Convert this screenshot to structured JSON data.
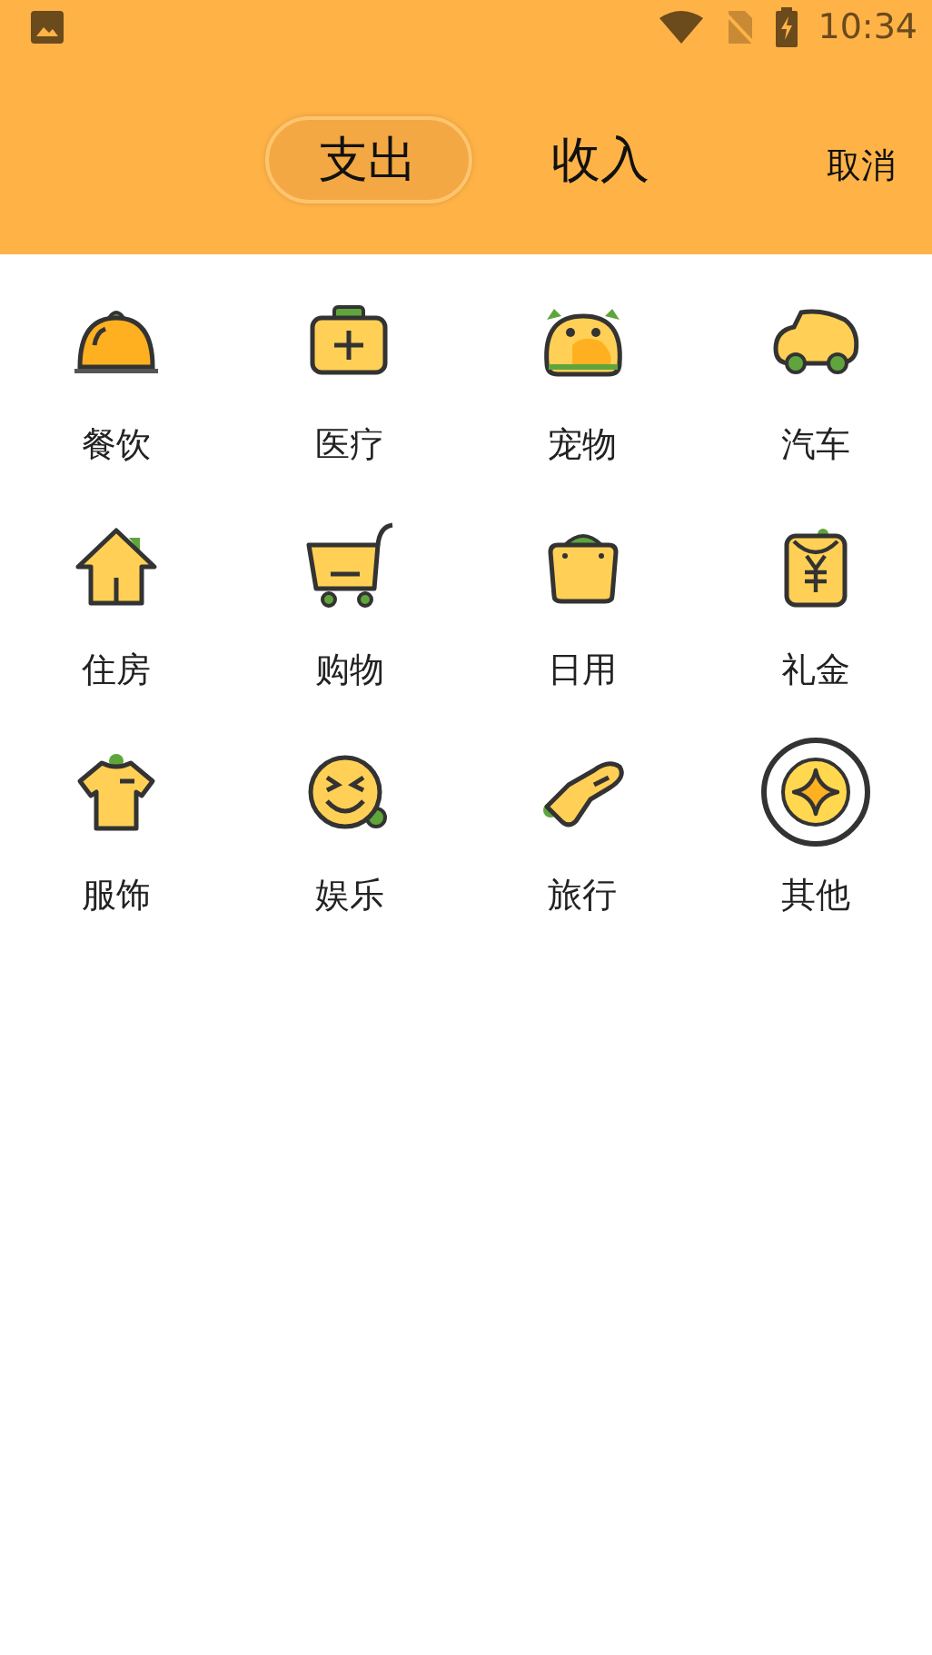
{
  "status_bar": {
    "time": "10:34"
  },
  "tabs": [
    {
      "label": "支出",
      "selected": true
    },
    {
      "label": "收入",
      "selected": false
    }
  ],
  "cancel": "取消",
  "categories": [
    {
      "label": "餐饮",
      "selected": false
    },
    {
      "label": "医疗",
      "selected": false
    },
    {
      "label": "宠物",
      "selected": false
    },
    {
      "label": "汽车",
      "selected": false
    },
    {
      "label": "住房",
      "selected": false
    },
    {
      "label": "购物",
      "selected": false
    },
    {
      "label": "日用",
      "selected": false
    },
    {
      "label": "礼金",
      "selected": false
    },
    {
      "label": "服饰",
      "selected": false
    },
    {
      "label": "娱乐",
      "selected": false
    },
    {
      "label": "旅行",
      "selected": false
    },
    {
      "label": "其他",
      "selected": true
    }
  ]
}
